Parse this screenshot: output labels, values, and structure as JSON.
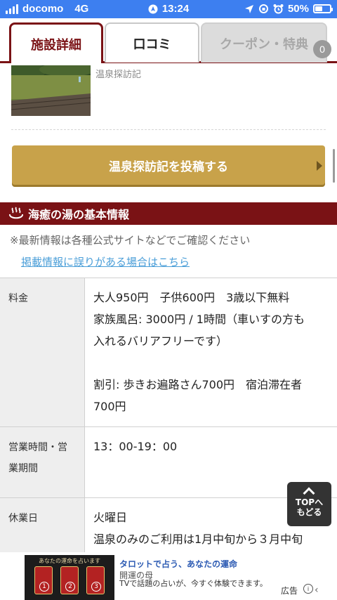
{
  "status_bar": {
    "carrier": "docomo",
    "network": "4G",
    "time": "13:24",
    "battery": "50%",
    "battery_level": 0.5,
    "bar_color": "#3d7ff0"
  },
  "tabs": [
    {
      "label": "施設詳細",
      "active": true
    },
    {
      "label": "口コミ",
      "active": false
    },
    {
      "label": "クーポン・特典",
      "active": false,
      "disabled": true
    }
  ],
  "coupon_badge": "0",
  "review": {
    "label": "温泉探訪記"
  },
  "post_button": {
    "label": "温泉探訪記を投稿する",
    "color": "#c8a24a"
  },
  "section": {
    "title": "海癒の湯の基本情報",
    "note": "※最新情報は各種公式サイトなどでご確認ください",
    "error_link": "掲載情報に誤りがある場合はこちら",
    "accent": "#7a1215"
  },
  "info_rows": [
    {
      "label": "料金",
      "lines": [
        "大人950円　子供600円　3歳以下無料",
        "家族風呂: 3000円 / 1時間（車いすの方も",
        "入れるバリアフリーです）",
        "",
        "割引: 歩きお遍路さん700円　宿泊滞在者",
        "700円"
      ]
    },
    {
      "label_lines": [
        "営業時間・営",
        "業期間"
      ],
      "lines": [
        "13：00-19：00"
      ]
    },
    {
      "label": "休業日",
      "lines": [
        "火曜日",
        "温泉のみのご利用は1月中旬から３月中旬"
      ]
    }
  ],
  "top_button": {
    "line1": "TOPへ",
    "line2": "もどる"
  },
  "ad": {
    "image_caption": "あなたの運命を占います",
    "card_numbers": [
      "1",
      "2",
      "3"
    ],
    "title": "タロットで占う、あなたの運命",
    "sponsor": "開運の母",
    "description": "TVで話題の占いが、今すぐ体験できます。",
    "label": "広告"
  },
  "icons": [
    "signal-icon",
    "location-arrow-icon",
    "lock-rotation-icon",
    "alarm-icon",
    "battery-icon",
    "onsen-icon",
    "chevron-right-icon",
    "chevron-up-icon",
    "info-icon",
    "close-icon"
  ]
}
